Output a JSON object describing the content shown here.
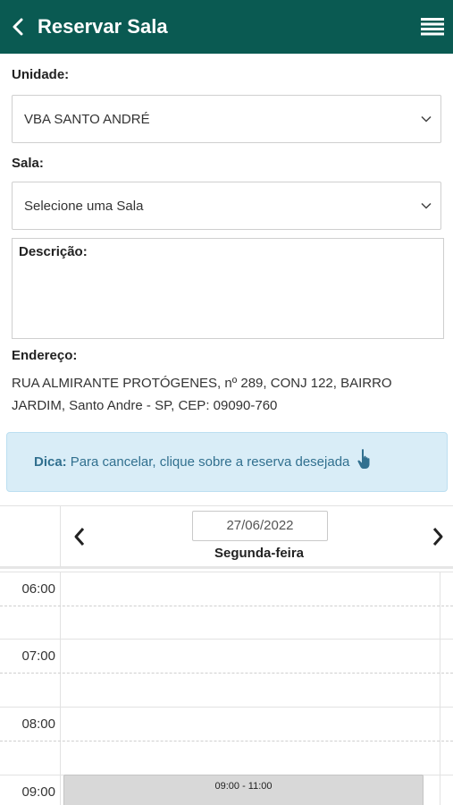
{
  "header": {
    "title": "Reservar Sala",
    "back_icon": "chevron-left-icon",
    "menu_icon": "hamburger-menu-icon",
    "bg_color": "#0a5a52"
  },
  "form": {
    "unidade_label": "Unidade:",
    "unidade_value": "VBA SANTO ANDRÉ",
    "sala_label": "Sala:",
    "sala_value": "Selecione uma Sala",
    "descricao_label": "Descrição:",
    "endereco_label": "Endereço:",
    "endereco_value": "RUA ALMIRANTE PROTÓGENES, nº 289, CONJ 122, BAIRRO JARDIM, Santo Andre - SP, CEP: 09090-760"
  },
  "tip": {
    "prefix": "Dica:",
    "text": "Para cancelar, clique sobre a reserva desejada",
    "icon": "hand-pointer-icon",
    "bg_color": "#d9edf7"
  },
  "calendar": {
    "date": "27/06/2022",
    "weekday": "Segunda-feira",
    "hours": [
      "06:00",
      "07:00",
      "08:00",
      "09:00"
    ],
    "events": [
      {
        "label": "09:00 - 11:00"
      }
    ]
  }
}
